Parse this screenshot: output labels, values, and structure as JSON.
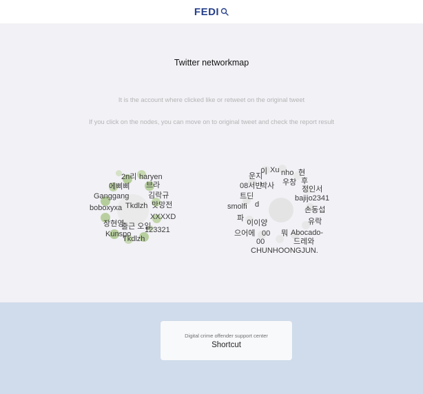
{
  "header": {
    "logo_text": "FEDI",
    "logo_icon": "search-icon",
    "brand_color": "#27408b"
  },
  "main": {
    "title": "Twitter networkmap",
    "description_1": "It is the account where clicked like or retweet on the original tweet",
    "description_2": "If you click on the nodes, you can move on to original tweet and check the report result",
    "networks": [
      {
        "labels": [
          "2n리",
          "haryen",
          "에삐삐",
          "브라",
          "Ganggang",
          "김락규",
          "boboxyxa",
          "Tkdlzh",
          "맛망전",
          "XXXXD",
          "장현영",
          "출근 오일",
          "123321",
          "Kunspo",
          "Tkdlzh"
        ]
      },
      {
        "labels": [
          "이",
          "운지",
          "Xu",
          "nho",
          "현",
          "08서빈",
          "박사",
          "우창",
          "후",
          "정인서",
          "트딘",
          "bajijo2341",
          "smolfi",
          "d",
          "손동섭",
          "파",
          "이이양",
          "유락",
          "으어에",
          "00",
          "뭐",
          "Abocado-",
          "00",
          "드레와",
          "CHUNHOONGJUN."
        ]
      }
    ]
  },
  "footer": {
    "shortcut_subtitle": "Digital crime offender support center",
    "shortcut_label": "Shortcut"
  }
}
